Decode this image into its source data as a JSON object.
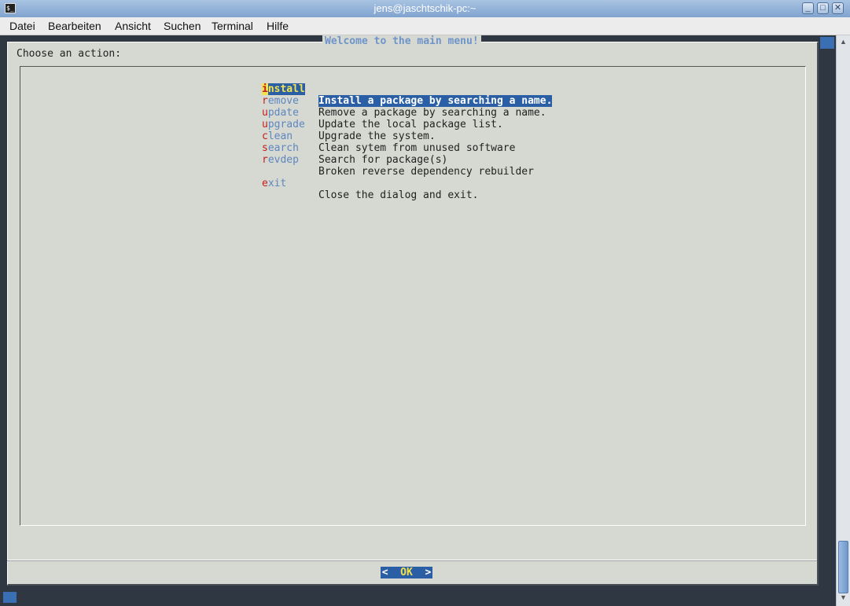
{
  "window": {
    "title": "jens@jaschtschik-pc:~",
    "terminal_icon": "$_",
    "buttons": {
      "minimize": "_",
      "maximize": "□",
      "close": "✕"
    }
  },
  "menubar": {
    "items": [
      "Datei",
      "Bearbeiten",
      "Ansicht",
      "Suchen",
      "Terminal",
      "Hilfe"
    ]
  },
  "dialog": {
    "title": "Welcome to the main menu!",
    "prompt": "Choose an action:",
    "items": [
      {
        "hot": "i",
        "rest": "nstall",
        "desc": "Install a package by searching a name.",
        "selected": true
      },
      {
        "hot": "r",
        "rest": "emove",
        "desc": "Remove a package by searching a name."
      },
      {
        "hot": "u",
        "rest": "pdate",
        "desc": "Update the local package list."
      },
      {
        "hot": "u",
        "rest": "pgrade",
        "desc": "Upgrade the system."
      },
      {
        "hot": "c",
        "rest": "lean",
        "desc": "Clean sytem from unused software"
      },
      {
        "hot": "s",
        "rest": "earch",
        "desc": "Search for package(s)"
      },
      {
        "hot": "r",
        "rest": "evdep",
        "desc": "Broken reverse dependency rebuilder"
      },
      {
        "hot": "e",
        "rest": "xit",
        "desc": "Close the dialog and exit."
      }
    ],
    "ok_button": {
      "left": "<  ",
      "label": "OK",
      "right": "  >"
    }
  },
  "colors": {
    "dialog_bg": "#d6d9d2",
    "selection_bg": "#2a5fa6",
    "hotkey": "#c41d1d",
    "tag_text": "#5e86c0",
    "terminal_bg": "#2f3742"
  }
}
